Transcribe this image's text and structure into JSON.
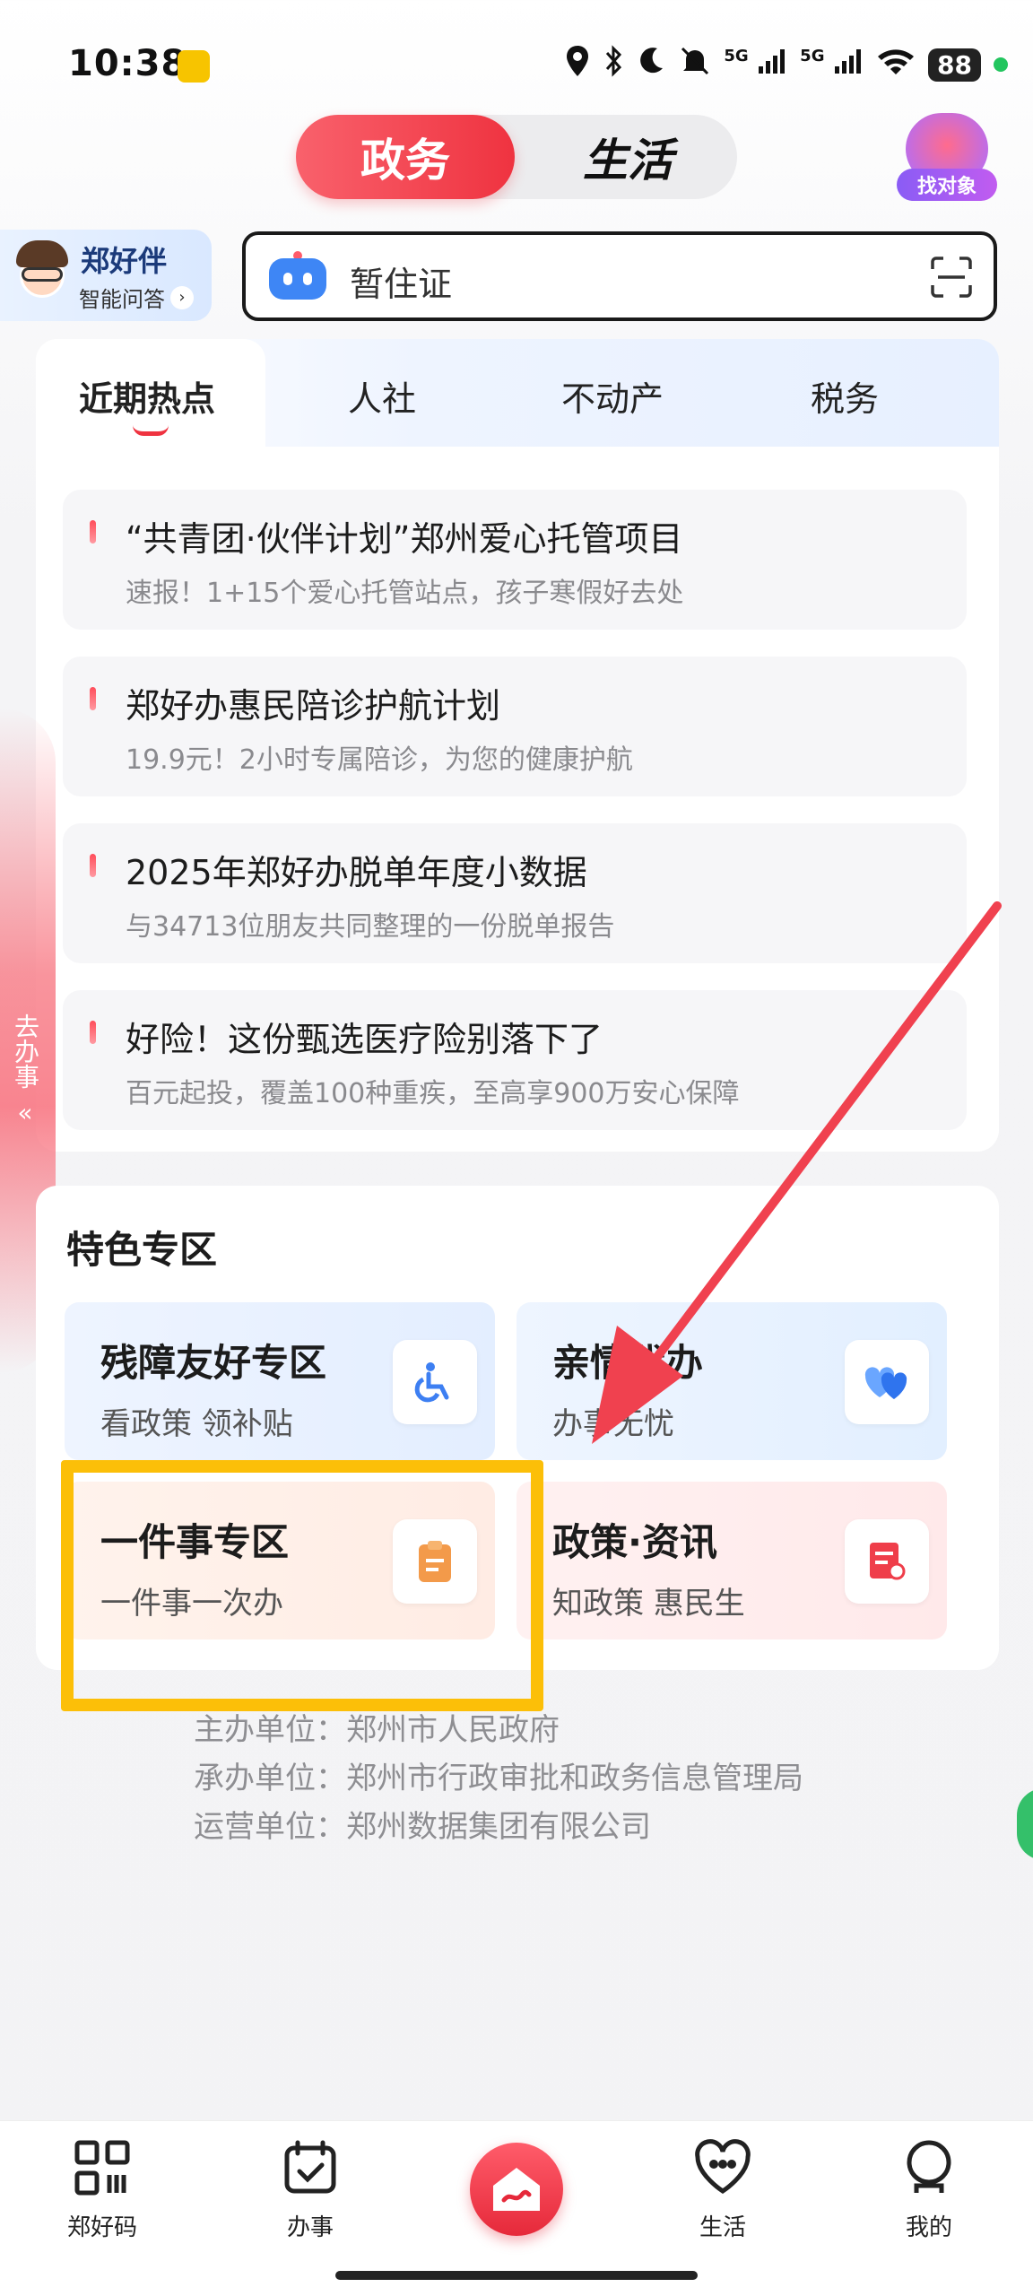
{
  "status_bar": {
    "time": "10:38",
    "network_1": "5G",
    "network_2": "5G",
    "battery": "88"
  },
  "top_tabs": {
    "active": "政务",
    "inactive": "生活"
  },
  "find_badge": {
    "label": "找对象"
  },
  "assistant": {
    "name": "郑好伴",
    "subtitle": "智能问答",
    "chevron": "›"
  },
  "search": {
    "placeholder": "暂住证"
  },
  "hot": {
    "tabs": [
      "近期热点",
      "人社",
      "不动产",
      "税务"
    ],
    "items": [
      {
        "title": "“共青团·伙伴计划”郑州爱心托管项目",
        "sub": "速报！1+15个爱心托管站点，孩子寒假好去处"
      },
      {
        "title": "郑好办惠民陪诊护航计划",
        "sub": "19.9元！2小时专属陪诊，为您的健康护航"
      },
      {
        "title": "2025年郑好办脱单年度小数据",
        "sub": "与34713位朋友共同整理的一份脱单报告"
      },
      {
        "title": "好险！这份甄选医疗险别落下了",
        "sub": "百元起投，覆盖100种重疾，至高享900万安心保障"
      }
    ]
  },
  "side_tab": {
    "label": "去办事",
    "chevron": "«"
  },
  "feature": {
    "title": "特色专区",
    "tiles": [
      {
        "title": "残障友好专区",
        "sub": "看政策 领补贴",
        "icon": "wheelchair-icon"
      },
      {
        "title": "亲情代办",
        "sub": "办事无忧",
        "icon": "hearts-icon"
      },
      {
        "title": "一件事专区",
        "sub": "一件事一次办",
        "icon": "clipboard-icon"
      },
      {
        "title": "政策·资讯",
        "sub": "知政策 惠民生",
        "icon": "certificate-icon"
      }
    ]
  },
  "footer": {
    "line1": "主办单位：郑州市人民政府",
    "line2": "承办单位：郑州市行政审批和政务信息管理局",
    "line3": "运营单位：郑州数据集团有限公司"
  },
  "nav": {
    "items": [
      "郑好码",
      "办事",
      "生活",
      "我的"
    ]
  },
  "colors": {
    "accent": "#ef3340",
    "highlight": "#fcbf08",
    "arrow": "#f0414f"
  }
}
